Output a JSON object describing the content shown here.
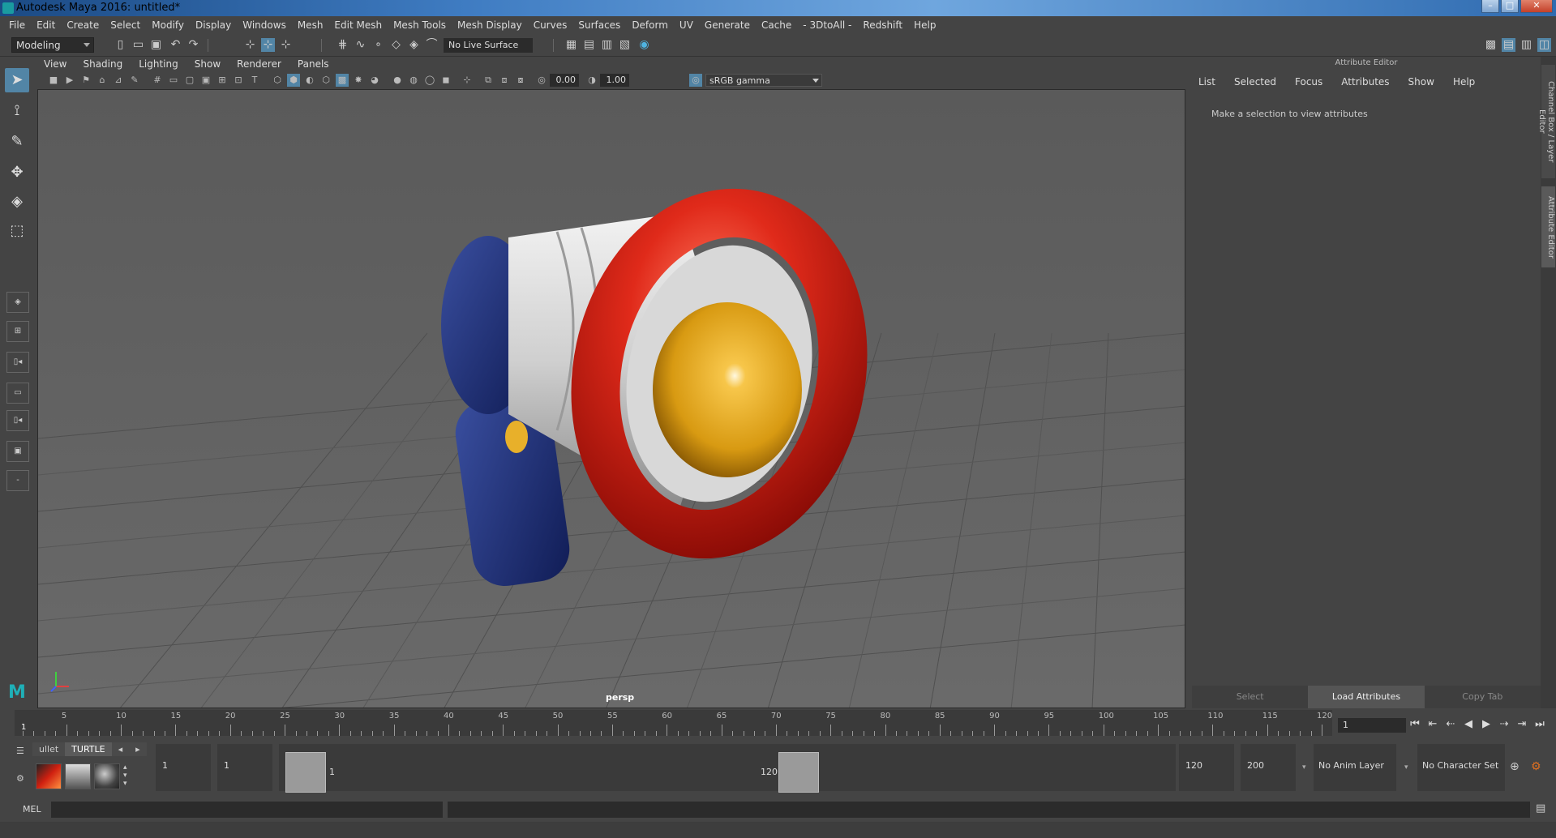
{
  "window": {
    "title": "Autodesk Maya 2016: untitled*"
  },
  "menu": [
    "File",
    "Edit",
    "Create",
    "Select",
    "Modify",
    "Display",
    "Windows",
    "Mesh",
    "Edit Mesh",
    "Mesh Tools",
    "Mesh Display",
    "Curves",
    "Surfaces",
    "Deform",
    "UV",
    "Generate",
    "Cache",
    "- 3DtoAll -",
    "Redshift",
    "Help"
  ],
  "toolrow": {
    "menuset": "Modeling",
    "live_surface": "No Live Surface"
  },
  "viewport": {
    "menu": [
      "View",
      "Shading",
      "Lighting",
      "Show",
      "Renderer",
      "Panels"
    ],
    "exposure": "0.00",
    "gamma": "1.00",
    "color_space": "sRGB gamma",
    "camera": "persp"
  },
  "attribute_editor": {
    "title": "Attribute Editor",
    "menu": [
      "List",
      "Selected",
      "Focus",
      "Attributes",
      "Show",
      "Help"
    ],
    "message": "Make a selection to view attributes",
    "buttons": [
      "Select",
      "Load Attributes",
      "Copy Tab"
    ],
    "side_tabs": [
      "Channel Box / Layer Editor",
      "Attribute Editor"
    ]
  },
  "timeline": {
    "ticks": [
      "5",
      "10",
      "15",
      "20",
      "25",
      "30",
      "35",
      "40",
      "45",
      "50",
      "55",
      "60",
      "65",
      "70",
      "75",
      "80",
      "85",
      "90",
      "95",
      "100",
      "105",
      "110",
      "115",
      "120"
    ],
    "start_label": "1",
    "current_frame": "1"
  },
  "range": {
    "shelf_tabs": [
      "ullet",
      "TURTLE"
    ],
    "start": "1",
    "anim_start": "1",
    "range_start": "1",
    "range_end": "120",
    "anim_end": "120",
    "end": "200",
    "anim_layer": "No Anim Layer",
    "character_set": "No Character Set"
  },
  "cmd": {
    "label": "MEL"
  },
  "colors": {
    "accent": "#5285a6",
    "panel": "#444444",
    "viewport": "#606060"
  }
}
